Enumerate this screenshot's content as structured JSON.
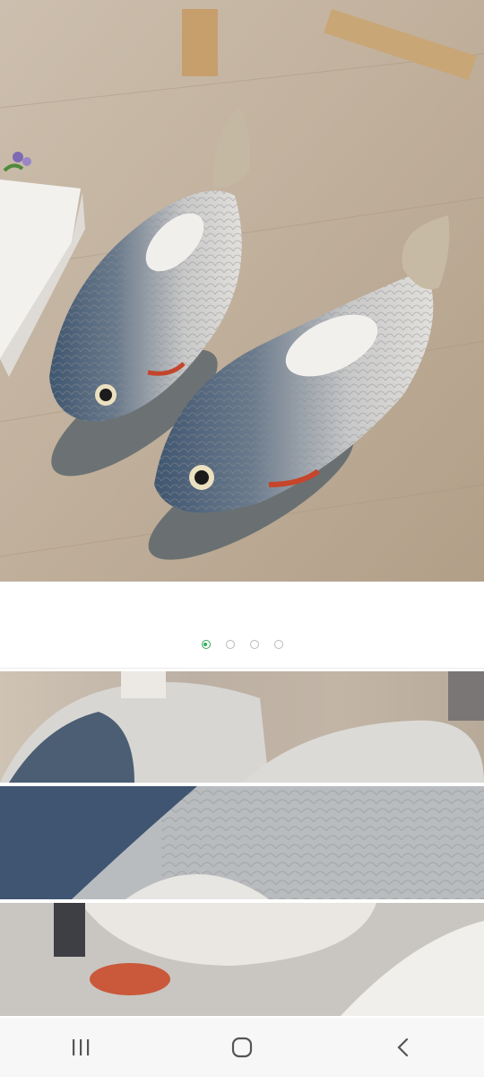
{
  "product_gallery": {
    "main_image": {
      "subject": "fish-slipper-pair-photo"
    },
    "carousel": {
      "total_slides": 4,
      "active_index": 0,
      "active_color": "#27b45a",
      "inactive_color": "#b9b9b9"
    },
    "detail_crops": [
      "slipper-top-crop",
      "fish-scale-crop",
      "slipper-opening-crop"
    ]
  },
  "system_nav": {
    "buttons": [
      "recent-apps-icon",
      "home-icon",
      "back-icon"
    ]
  }
}
